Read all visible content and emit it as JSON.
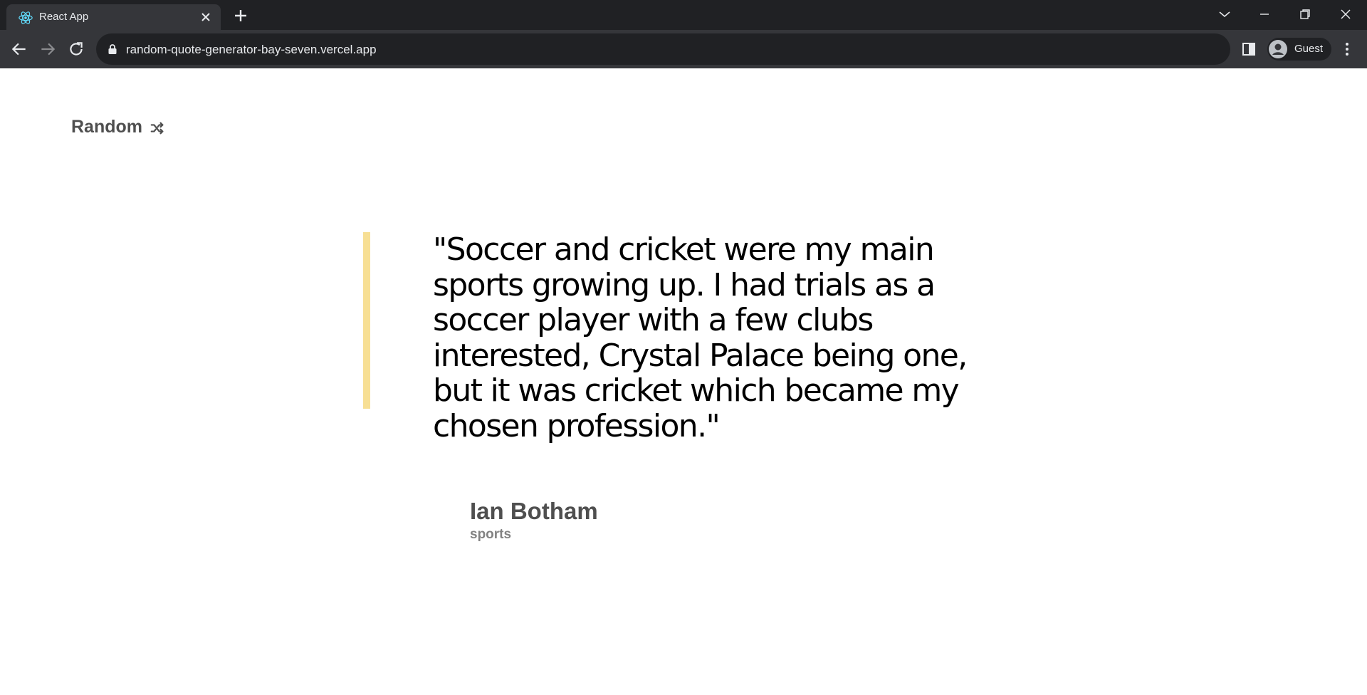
{
  "browser": {
    "tab_title": "React App",
    "url": "random-quote-generator-bay-seven.vercel.app",
    "profile_label": "Guest"
  },
  "page": {
    "random_button_label": "Random",
    "quote": "\"Soccer and cricket were my main sports growing up. I had trials as a soccer player with a few clubs interested, Crystal Palace being one, but it was cricket which became my chosen profession.\"",
    "author": "Ian Botham",
    "genre": "sports"
  },
  "colors": {
    "quote_accent": "#f7df94",
    "author": "#4f4f4f",
    "genre": "#828282",
    "chrome_dark": "#202124",
    "chrome_toolbar": "#35363a"
  },
  "icons": [
    "react-favicon-icon",
    "close-icon",
    "plus-icon",
    "chevron-down-icon",
    "minimize-icon",
    "restore-icon",
    "window-close-icon",
    "back-arrow-icon",
    "forward-arrow-icon",
    "reload-icon",
    "lock-icon",
    "side-panel-icon",
    "avatar-icon",
    "kebab-menu-icon",
    "shuffle-icon"
  ]
}
